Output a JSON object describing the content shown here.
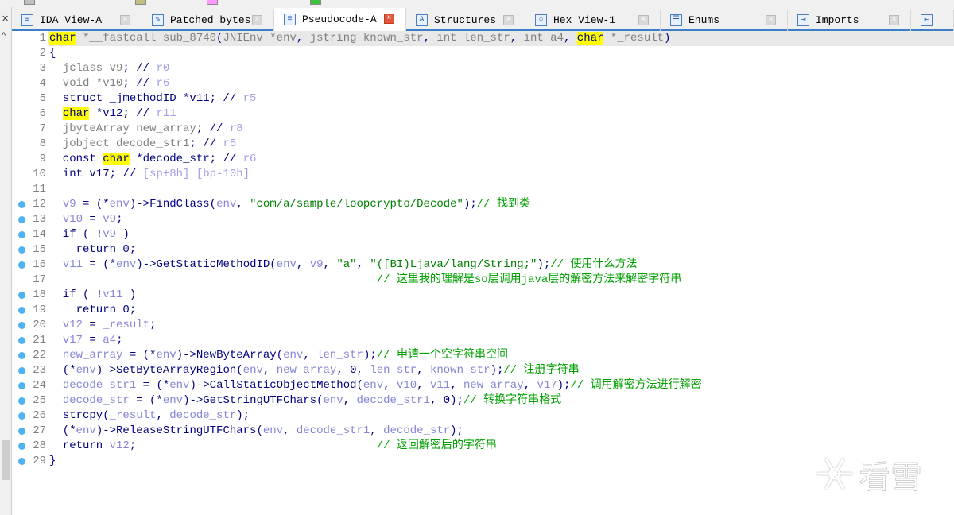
{
  "tabs": [
    {
      "label": "IDA View-A",
      "icon": "disassembly-view-icon",
      "active": false
    },
    {
      "label": "Patched bytes",
      "icon": "patch-icon",
      "active": false
    },
    {
      "label": "Pseudocode-A",
      "icon": "pseudocode-icon",
      "active": true
    },
    {
      "label": "Structures",
      "icon": "structures-icon",
      "active": false
    },
    {
      "label": "Hex View-1",
      "icon": "hex-view-icon",
      "active": false
    },
    {
      "label": "Enums",
      "icon": "enums-icon",
      "active": false
    },
    {
      "label": "Imports",
      "icon": "imports-icon",
      "active": false
    },
    {
      "label": "",
      "icon": "exports-icon",
      "active": false
    }
  ],
  "legend_colors": [
    "#c0c0c0",
    "#c0c080",
    "#ff99ff",
    "#40c040"
  ],
  "colors": {
    "accent": "#3c7fc7",
    "highlight": "#ffff00",
    "comment": "#00a000",
    "breakpoint_dot": "#4db3f2"
  },
  "code": {
    "lines": [
      {
        "n": "1",
        "dot": false,
        "tokens": [
          [
            "h",
            "char"
          ],
          [
            "g",
            " *__fastcall sub_8740"
          ],
          [
            "t",
            "("
          ],
          [
            "g",
            "JNIEnv *env"
          ],
          [
            "t",
            ", "
          ],
          [
            "g",
            "jstring known_str"
          ],
          [
            "t",
            ", "
          ],
          [
            "g",
            "int len_str"
          ],
          [
            "t",
            ", "
          ],
          [
            "g",
            "int a4"
          ],
          [
            "t",
            ", "
          ],
          [
            "h",
            "char"
          ],
          [
            "g",
            " *_result"
          ],
          [
            "t",
            ")"
          ]
        ]
      },
      {
        "n": "2",
        "dot": false,
        "tokens": [
          [
            "t",
            "{"
          ]
        ]
      },
      {
        "n": "3",
        "dot": false,
        "tokens": [
          [
            "g",
            "  jclass v9"
          ],
          [
            "t",
            "; // "
          ],
          [
            "r",
            "r0"
          ]
        ]
      },
      {
        "n": "4",
        "dot": false,
        "tokens": [
          [
            "g",
            "  void *v10"
          ],
          [
            "t",
            "; // "
          ],
          [
            "r",
            "r6"
          ]
        ]
      },
      {
        "n": "5",
        "dot": false,
        "tokens": [
          [
            "t",
            "  struct _jmethodID *v11; // "
          ],
          [
            "r",
            "r5"
          ]
        ]
      },
      {
        "n": "6",
        "dot": false,
        "tokens": [
          [
            "t",
            "  "
          ],
          [
            "h",
            "char"
          ],
          [
            "t",
            " *v12; // "
          ],
          [
            "r",
            "r11"
          ]
        ]
      },
      {
        "n": "7",
        "dot": false,
        "tokens": [
          [
            "g",
            "  jbyteArray new_array"
          ],
          [
            "t",
            "; // "
          ],
          [
            "r",
            "r8"
          ]
        ]
      },
      {
        "n": "8",
        "dot": false,
        "tokens": [
          [
            "g",
            "  jobject decode_str1"
          ],
          [
            "t",
            "; // "
          ],
          [
            "r",
            "r5"
          ]
        ]
      },
      {
        "n": "9",
        "dot": false,
        "tokens": [
          [
            "t",
            "  const "
          ],
          [
            "h",
            "char"
          ],
          [
            "t",
            " *decode_str; // "
          ],
          [
            "r",
            "r6"
          ]
        ]
      },
      {
        "n": "10",
        "dot": false,
        "tokens": [
          [
            "t",
            "  int v17; // "
          ],
          [
            "r",
            "[sp+8h] [bp-10h]"
          ]
        ]
      },
      {
        "n": "11",
        "dot": false,
        "tokens": []
      },
      {
        "n": "12",
        "dot": true,
        "tokens": [
          [
            "t",
            "  "
          ],
          [
            "v",
            "v9"
          ],
          [
            "t",
            " = (*"
          ],
          [
            "v",
            "env"
          ],
          [
            "t",
            ")->FindClass("
          ],
          [
            "v",
            "env"
          ],
          [
            "t",
            ", "
          ],
          [
            "s",
            "\"com/a/sample/loopcrypto/Decode\""
          ],
          [
            "t",
            ");"
          ],
          [
            "c",
            "// 找到类"
          ]
        ]
      },
      {
        "n": "13",
        "dot": true,
        "tokens": [
          [
            "t",
            "  "
          ],
          [
            "v",
            "v10"
          ],
          [
            "t",
            " = "
          ],
          [
            "v",
            "v9"
          ],
          [
            "t",
            ";"
          ]
        ]
      },
      {
        "n": "14",
        "dot": true,
        "tokens": [
          [
            "t",
            "  if ( !"
          ],
          [
            "v",
            "v9"
          ],
          [
            "t",
            " )"
          ]
        ]
      },
      {
        "n": "15",
        "dot": true,
        "tokens": [
          [
            "t",
            "    return 0;"
          ]
        ]
      },
      {
        "n": "16",
        "dot": true,
        "tokens": [
          [
            "t",
            "  "
          ],
          [
            "v",
            "v11"
          ],
          [
            "t",
            " = (*"
          ],
          [
            "v",
            "env"
          ],
          [
            "t",
            ")->GetStaticMethodID("
          ],
          [
            "v",
            "env"
          ],
          [
            "t",
            ", "
          ],
          [
            "v",
            "v9"
          ],
          [
            "t",
            ", "
          ],
          [
            "s",
            "\"a\""
          ],
          [
            "t",
            ", "
          ],
          [
            "s",
            "\"([BI)Ljava/lang/String;\""
          ],
          [
            "t",
            ");"
          ],
          [
            "c",
            "// 使用什么方法"
          ]
        ]
      },
      {
        "n": "17",
        "dot": false,
        "tokens": [
          [
            "t",
            "                                                 "
          ],
          [
            "c",
            "// 这里我的理解是so层调用java层的解密方法来解密字符串"
          ]
        ]
      },
      {
        "n": "18",
        "dot": true,
        "tokens": [
          [
            "t",
            "  if ( !"
          ],
          [
            "v",
            "v11"
          ],
          [
            "t",
            " )"
          ]
        ]
      },
      {
        "n": "19",
        "dot": true,
        "tokens": [
          [
            "t",
            "    return 0;"
          ]
        ]
      },
      {
        "n": "20",
        "dot": true,
        "tokens": [
          [
            "t",
            "  "
          ],
          [
            "v",
            "v12"
          ],
          [
            "t",
            " = "
          ],
          [
            "v",
            "_result"
          ],
          [
            "t",
            ";"
          ]
        ]
      },
      {
        "n": "21",
        "dot": true,
        "tokens": [
          [
            "t",
            "  "
          ],
          [
            "v",
            "v17"
          ],
          [
            "t",
            " = "
          ],
          [
            "v",
            "a4"
          ],
          [
            "t",
            ";"
          ]
        ]
      },
      {
        "n": "22",
        "dot": true,
        "tokens": [
          [
            "t",
            "  "
          ],
          [
            "v",
            "new_array"
          ],
          [
            "t",
            " = (*"
          ],
          [
            "v",
            "env"
          ],
          [
            "t",
            ")->NewByteArray("
          ],
          [
            "v",
            "env"
          ],
          [
            "t",
            ", "
          ],
          [
            "v",
            "len_str"
          ],
          [
            "t",
            ");"
          ],
          [
            "c",
            "// 申请一个空字符串空间"
          ]
        ]
      },
      {
        "n": "23",
        "dot": true,
        "tokens": [
          [
            "t",
            "  (*"
          ],
          [
            "v",
            "env"
          ],
          [
            "t",
            ")->SetByteArrayRegion("
          ],
          [
            "v",
            "env"
          ],
          [
            "t",
            ", "
          ],
          [
            "v",
            "new_array"
          ],
          [
            "t",
            ", 0, "
          ],
          [
            "v",
            "len_str"
          ],
          [
            "t",
            ", "
          ],
          [
            "v",
            "known_str"
          ],
          [
            "t",
            ");"
          ],
          [
            "c",
            "// 注册字符串"
          ]
        ]
      },
      {
        "n": "24",
        "dot": true,
        "tokens": [
          [
            "t",
            "  "
          ],
          [
            "v",
            "decode_str1"
          ],
          [
            "t",
            " = (*"
          ],
          [
            "v",
            "env"
          ],
          [
            "t",
            ")->CallStaticObjectMethod("
          ],
          [
            "v",
            "env"
          ],
          [
            "t",
            ", "
          ],
          [
            "v",
            "v10"
          ],
          [
            "t",
            ", "
          ],
          [
            "v",
            "v11"
          ],
          [
            "t",
            ", "
          ],
          [
            "v",
            "new_array"
          ],
          [
            "t",
            ", "
          ],
          [
            "v",
            "v17"
          ],
          [
            "t",
            ");"
          ],
          [
            "c",
            "// 调用解密方法进行解密"
          ]
        ]
      },
      {
        "n": "25",
        "dot": true,
        "tokens": [
          [
            "t",
            "  "
          ],
          [
            "v",
            "decode_str"
          ],
          [
            "t",
            " = (*"
          ],
          [
            "v",
            "env"
          ],
          [
            "t",
            ")->GetStringUTFChars("
          ],
          [
            "v",
            "env"
          ],
          [
            "t",
            ", "
          ],
          [
            "v",
            "decode_str1"
          ],
          [
            "t",
            ", 0);"
          ],
          [
            "c",
            "// 转换字符串格式"
          ]
        ]
      },
      {
        "n": "26",
        "dot": true,
        "tokens": [
          [
            "t",
            "  strcpy("
          ],
          [
            "v",
            "_result"
          ],
          [
            "t",
            ", "
          ],
          [
            "v",
            "decode_str"
          ],
          [
            "t",
            ");"
          ]
        ]
      },
      {
        "n": "27",
        "dot": true,
        "tokens": [
          [
            "t",
            "  (*"
          ],
          [
            "v",
            "env"
          ],
          [
            "t",
            ")->ReleaseStringUTFChars("
          ],
          [
            "v",
            "env"
          ],
          [
            "t",
            ", "
          ],
          [
            "v",
            "decode_str1"
          ],
          [
            "t",
            ", "
          ],
          [
            "v",
            "decode_str"
          ],
          [
            "t",
            ");"
          ]
        ]
      },
      {
        "n": "28",
        "dot": true,
        "tokens": [
          [
            "t",
            "  return "
          ],
          [
            "v",
            "v12"
          ],
          [
            "t",
            ";                                    "
          ],
          [
            "c",
            "// 返回解密后的字符串"
          ]
        ]
      },
      {
        "n": "29",
        "dot": true,
        "tokens": [
          [
            "t",
            "}"
          ]
        ]
      }
    ]
  },
  "watermark": {
    "text": "看雪"
  }
}
